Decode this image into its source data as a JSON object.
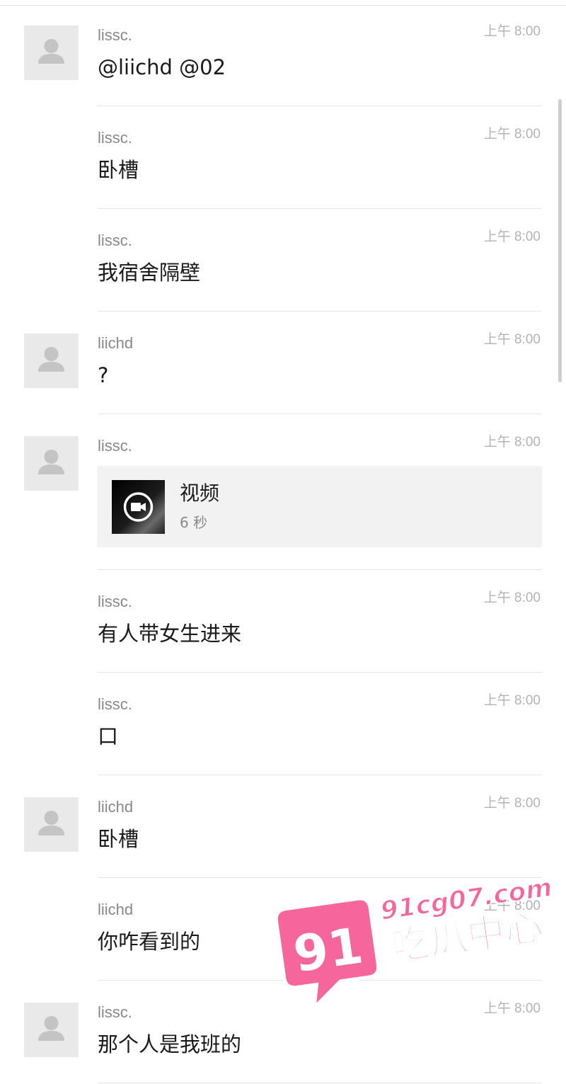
{
  "messages": [
    {
      "sender": "lissc.",
      "time": "上午 8:00",
      "text": "@liichd @02",
      "avatar": true
    },
    {
      "sender": "lissc.",
      "time": "上午 8:00",
      "text": "卧槽",
      "avatar": false
    },
    {
      "sender": "lissc.",
      "time": "上午 8:00",
      "text": "我宿舍隔壁",
      "avatar": false
    },
    {
      "sender": "liichd",
      "time": "上午 8:00",
      "text": "?",
      "avatar": true
    },
    {
      "sender": "lissc.",
      "time": "上午 8:00",
      "video": {
        "title": "视频",
        "duration": "6 秒",
        "icon": "video-camera-icon"
      },
      "avatar": true
    },
    {
      "sender": "lissc.",
      "time": "上午 8:00",
      "text": "有人带女生进来",
      "avatar": false
    },
    {
      "sender": "lissc.",
      "time": "上午 8:00",
      "text": "口",
      "avatar": false
    },
    {
      "sender": "liichd",
      "time": "上午 8:00",
      "text": "卧槽",
      "avatar": true
    },
    {
      "sender": "liichd",
      "time": "上午 8:00",
      "text": "你咋看到的",
      "avatar": false
    },
    {
      "sender": "lissc.",
      "time": "上午 8:00",
      "text": "那个人是我班的",
      "avatar": true
    }
  ],
  "watermark": {
    "number": "91",
    "domain": "91cg07.com",
    "name": "吃瓜中心",
    "color": "#f5679c"
  },
  "icons": {
    "avatar": "default-user-icon",
    "video": "video-camera-icon"
  },
  "colors": {
    "sender": "#888888",
    "time": "#b3b3b3",
    "text": "#1a1a1a",
    "avatar_bg": "#e9e9e9",
    "separator": "#e6e6e6"
  }
}
